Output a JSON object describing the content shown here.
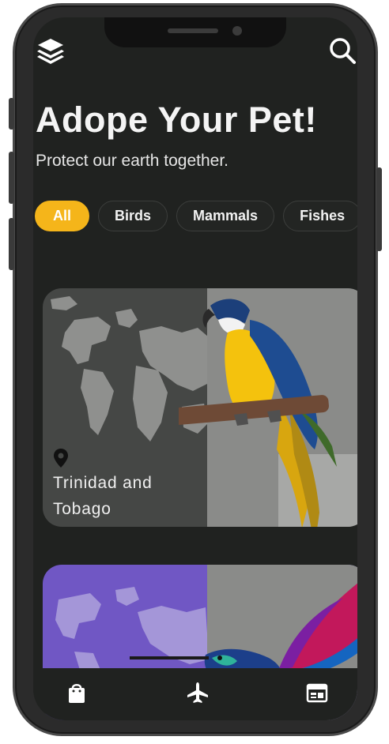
{
  "header": {
    "title": "Adope Your Pet!",
    "subtitle": "Protect our earth together."
  },
  "icons": {
    "menu": "layers-icon",
    "search": "search-icon",
    "location": "location-pin-icon",
    "nav_left": "shopping-bag-icon",
    "nav_center": "airplane-icon",
    "nav_right": "calendar-icon"
  },
  "filters": {
    "active": "All",
    "chips": [
      "All",
      "Birds",
      "Mammals",
      "Fishes"
    ]
  },
  "cards": [
    {
      "location": "Trinidad and Tobago",
      "animal": "macaw-parrot",
      "theme_color": "#454745"
    },
    {
      "location": "",
      "animal": "hummingbird",
      "theme_color": "#7057c4"
    }
  ],
  "colors": {
    "background": "#202220",
    "accent": "#f5b51a",
    "text": "#f4f4f4"
  }
}
